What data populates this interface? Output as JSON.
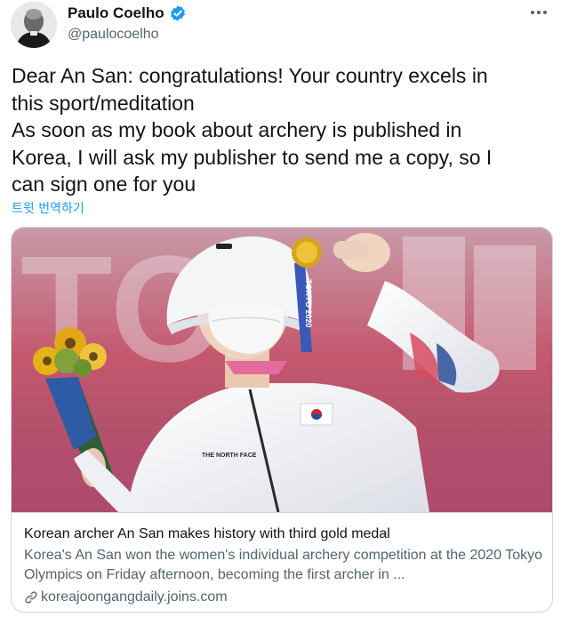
{
  "author": {
    "name": "Paulo Coelho",
    "handle": "@paulocoelho",
    "verified": true
  },
  "tweet": {
    "text": "Dear An San: congratulations! Your country excels in\nthis sport/meditation\nAs soon as my book about archery is published in\nKorea, I will ask my publisher to send me a copy, so I\ncan sign one for you",
    "translate_label": "트윗 번역하기"
  },
  "card": {
    "title": "Korean archer An San makes history with third gold medal",
    "description": "Korea's An San won the women's individual archery competition at the 2020 Tokyo Olympics on Friday afternoon, becoming the first archer in ...",
    "domain": "koreajoongangdaily.joins.com",
    "image_text": {
      "backdrop": "TO",
      "lanyard": "TOKYO 2020",
      "jacket_logo": "THE NORTH FACE"
    }
  },
  "icons": {
    "verified": "verified-badge-icon",
    "more": "more-dots-icon",
    "link": "link-icon"
  },
  "colors": {
    "accent": "#1d9bf0",
    "text": "#0f1419",
    "secondary": "#536471",
    "border": "#cfd9de"
  }
}
